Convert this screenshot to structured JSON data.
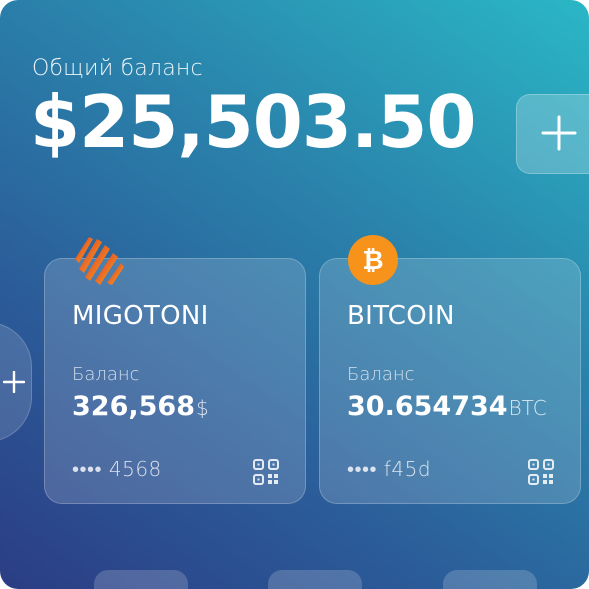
{
  "header": {
    "balance_label": "Общий баланс",
    "balance_amount": "$25,503.50"
  },
  "cards": [
    {
      "title": "MIGOTONI",
      "balance_label": "Баланс",
      "balance_value": "326,568",
      "balance_unit": "$",
      "number_masked": "•••• 4568",
      "logo_icon": "migotoni-logo-icon",
      "logo_colors": [
        "#e02a22",
        "#f7b426"
      ]
    },
    {
      "title": "BITCOIN",
      "balance_label": "Баланс",
      "balance_value": "30.654734",
      "balance_unit": "BTC",
      "number_masked": "•••• f45d",
      "logo_icon": "bitcoin-logo-icon",
      "logo_color": "#f7931a",
      "logo_symbol": "₿"
    }
  ],
  "colors": {
    "background_start": "#2b3d84",
    "background_end": "#2ab7c6"
  }
}
